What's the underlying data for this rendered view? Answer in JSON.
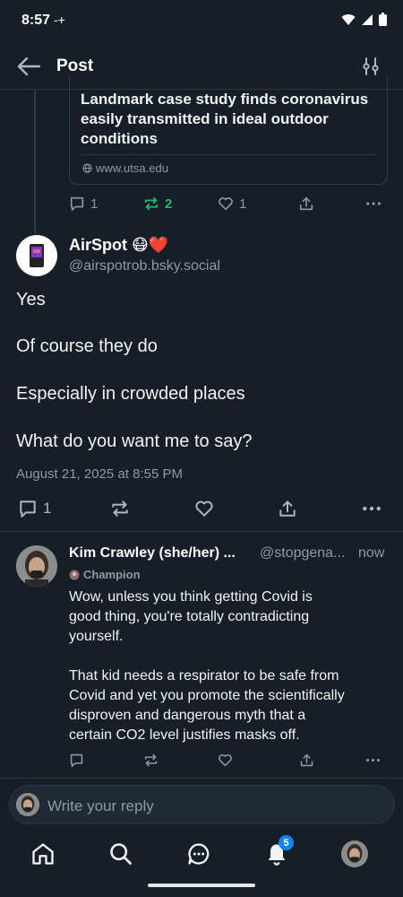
{
  "status": {
    "time": "8:57",
    "extra": "-+"
  },
  "header": {
    "title": "Post"
  },
  "quoted_card": {
    "title": "Landmark case study finds coronavirus easily transmitted in ideal outdoor conditions",
    "domain": "www.utsa.edu"
  },
  "parent_actions": {
    "replies": "1",
    "reposts": "2",
    "likes": "1"
  },
  "main_post": {
    "name": "AirSpot 😷❤️",
    "handle": "@airspotrob.bsky.social",
    "lines": [
      "Yes",
      "Of course they do",
      "Especially in crowded places",
      "What do you want me to say?"
    ],
    "date": "August 21, 2025 at 8:55 PM",
    "replies": "1"
  },
  "reply": {
    "name": "Kim Crawley (she/her) ...",
    "handle": "@stopgena...",
    "time": "now",
    "badge": "Champion",
    "body_lines": [
      "Wow, unless you think getting Covid is",
      "good thing, you're totally contradicting",
      "yourself.",
      "",
      "That kid needs a respirator to be safe from",
      "Covid and yet you promote the scientifically",
      "disproven and dangerous myth that a",
      "certain CO2 level justifies masks off."
    ]
  },
  "composer": {
    "placeholder": "Write your reply"
  },
  "tabbar": {
    "notification_count": "5"
  },
  "colors": {
    "background": "#161e27",
    "accent_green": "#20bc6f",
    "accent_blue": "#1083fe",
    "muted": "#8d99a6"
  }
}
